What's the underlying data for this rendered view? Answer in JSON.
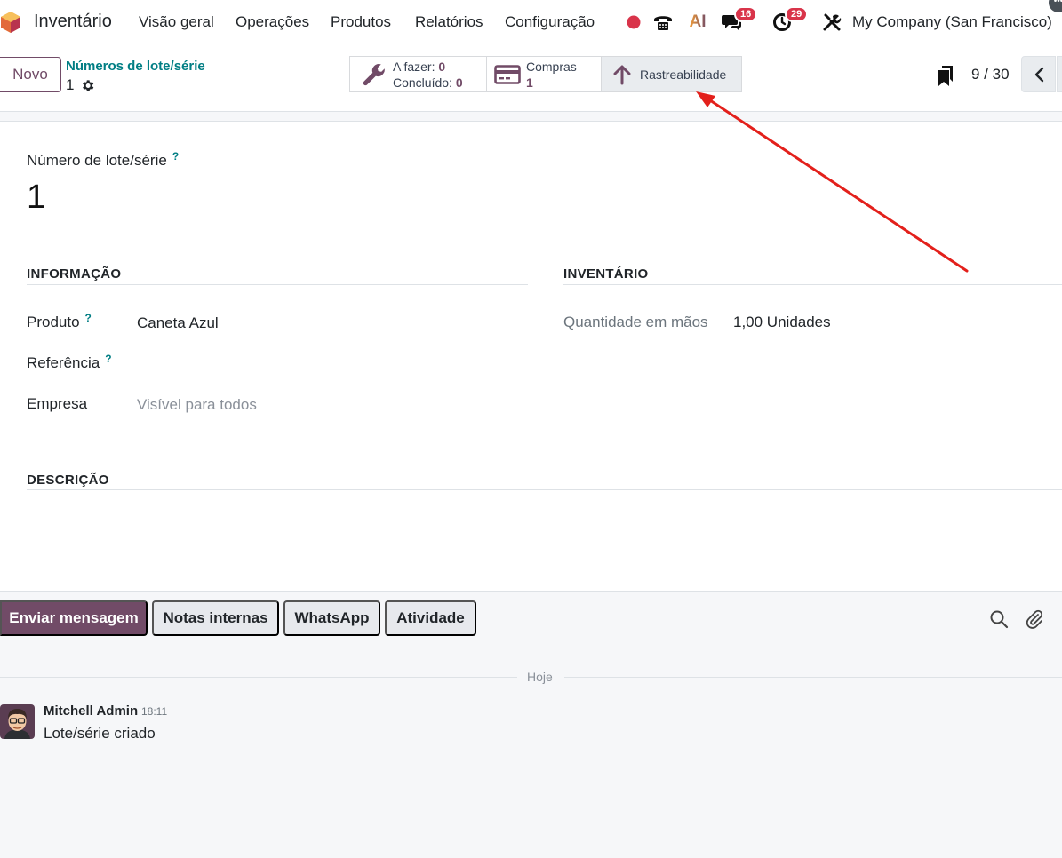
{
  "navbar": {
    "app_name": "Inventário",
    "menu": [
      "Visão geral",
      "Operações",
      "Produtos",
      "Relatórios",
      "Configuração"
    ],
    "messages_count": "16",
    "activities_count": "29",
    "ai_label": "AI",
    "company": "My Company (San Francisco)"
  },
  "control_panel": {
    "new_button": "Novo",
    "breadcrumb_parent": "Números de lote/série",
    "breadcrumb_current": "1",
    "smart_buttons": {
      "todo_label": "A fazer:",
      "todo_value": "0",
      "done_label": "Concluído:",
      "done_value": "0",
      "purchases_label": "Compras",
      "purchases_value": "1",
      "traceability_label": "Rastreabilidade"
    },
    "pager": "9 / 30"
  },
  "form": {
    "name_label": "Número de lote/série",
    "help_mark": "?",
    "name_value": "1",
    "info_section": "INFORMAÇÃO",
    "inventory_section": "INVENTÁRIO",
    "description_section": "DESCRIÇÃO",
    "product_label": "Produto",
    "product_value": "Caneta Azul",
    "reference_label": "Referência",
    "company_label": "Empresa",
    "company_placeholder": "Visível para todos",
    "qty_label": "Quantidade em mãos",
    "qty_value": "1,00 Unidades"
  },
  "chatter": {
    "send_message": "Enviar mensagem",
    "internal_notes": "Notas internas",
    "whatsapp": "WhatsApp",
    "activity": "Atividade",
    "date_separator": "Hoje",
    "message": {
      "author": "Mitchell Admin",
      "time": "18:11",
      "body": "Lote/série criado"
    }
  },
  "colors": {
    "brand": "#714b67",
    "link": "#017e84",
    "badge": "#d9344a",
    "annotation_arrow": "#e3201b"
  }
}
